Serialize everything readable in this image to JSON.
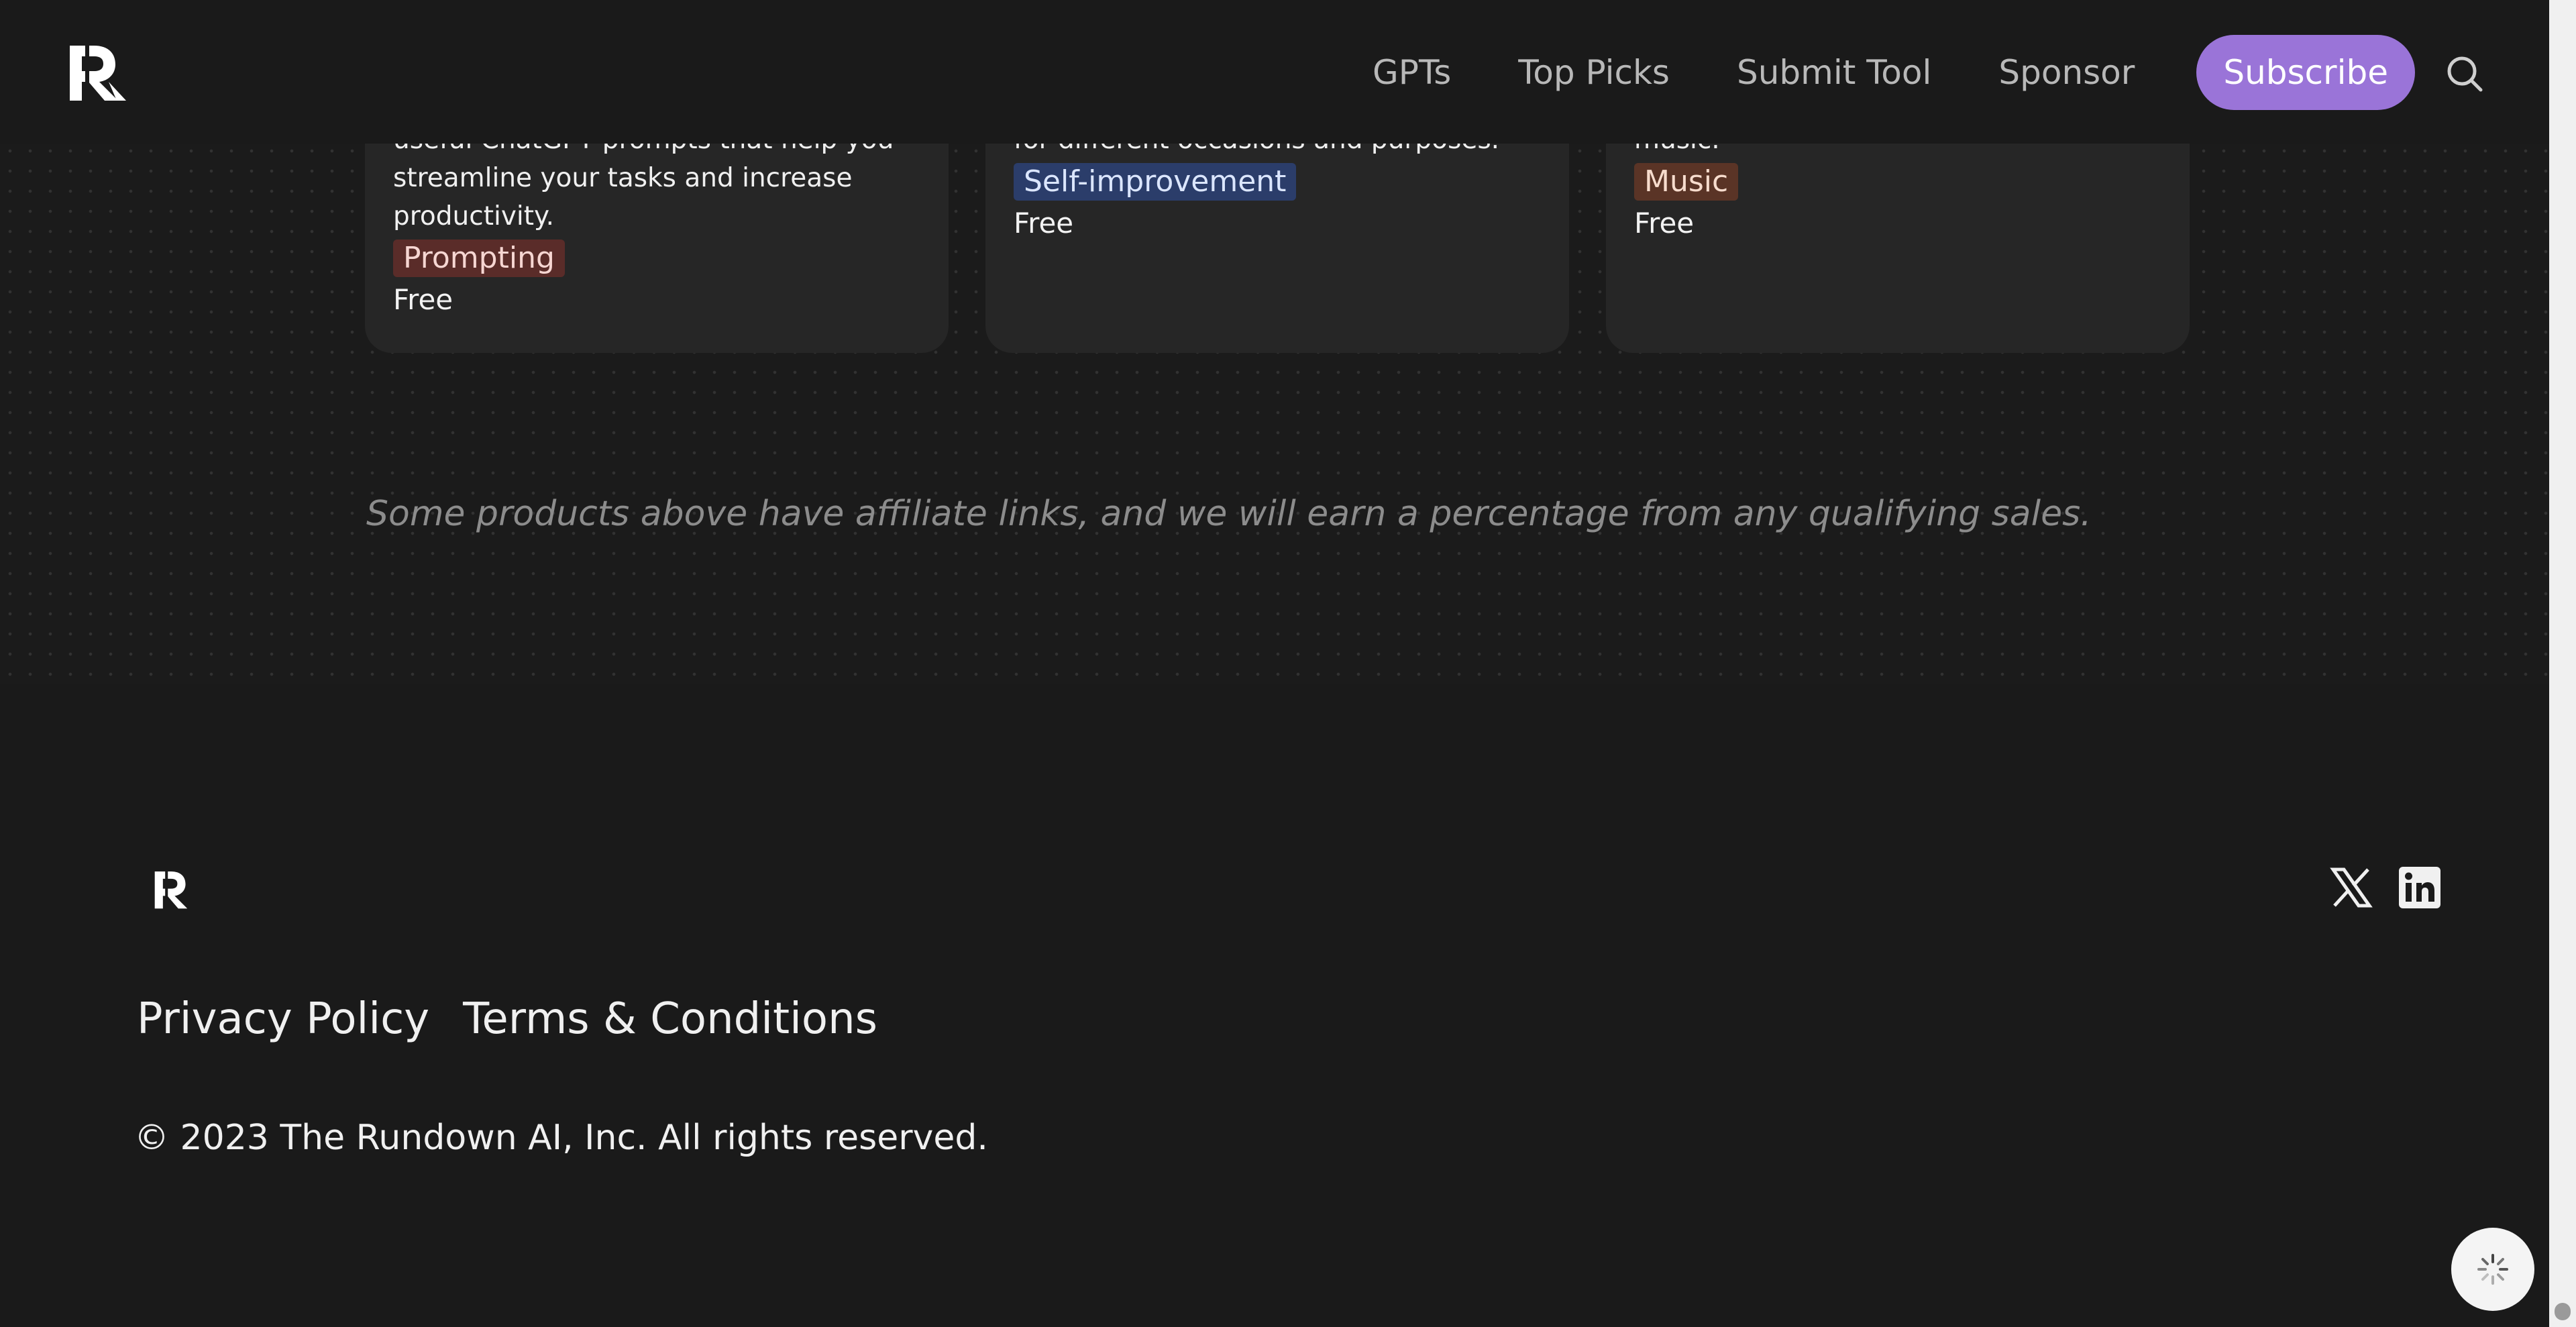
{
  "header": {
    "logo_icon": "rundown-logo-icon",
    "nav": [
      {
        "label": "GPTs"
      },
      {
        "label": "Top Picks"
      },
      {
        "label": "Submit Tool"
      },
      {
        "label": "Sponsor"
      }
    ],
    "subscribe_label": "Subscribe",
    "search_icon": "search-icon"
  },
  "cards": [
    {
      "description_lines": [
        "useful ChatGPT prompts that help you",
        "streamline your tasks and increase",
        "productivity."
      ],
      "tag": "Prompting",
      "price": "Free"
    },
    {
      "description_lines": [
        "for different occasions and purposes."
      ],
      "tag": "Self-improvement",
      "price": "Free"
    },
    {
      "description_lines": [
        "music."
      ],
      "tag": "Music",
      "price": "Free"
    }
  ],
  "disclaimer": "Some products above have affiliate links, and we will earn a percentage from any qualifying sales.",
  "footer": {
    "logo_icon": "rundown-logo-icon",
    "social_icons": [
      "x-icon",
      "linkedin-icon"
    ],
    "links": [
      {
        "label": "Privacy Policy"
      },
      {
        "label": "Terms & Conditions"
      }
    ],
    "copyright": "© 2023 The Rundown AI, Inc. All rights reserved."
  },
  "colors": {
    "background": "#1a1a1a",
    "card": "#262626",
    "accent": "#9a74d8"
  }
}
